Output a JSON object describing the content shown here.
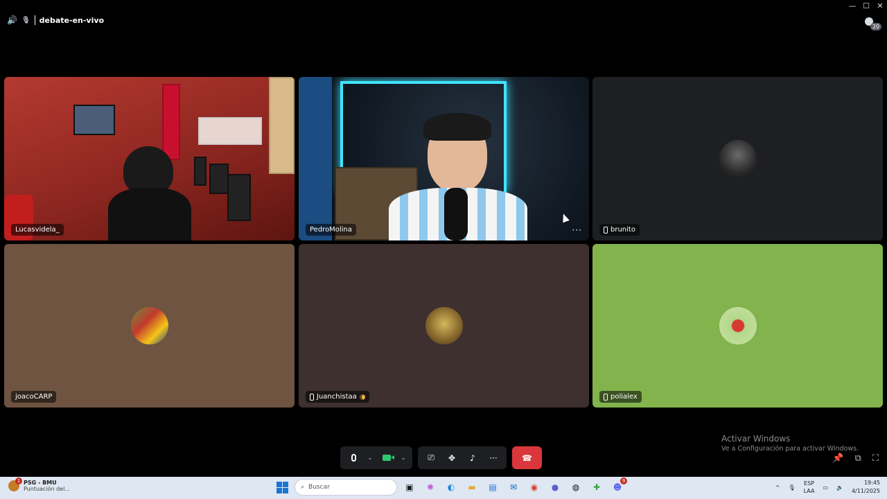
{
  "window": {
    "controls": {
      "minimize": "—",
      "maximize": "☐",
      "close": "✕"
    }
  },
  "header": {
    "channel_name": "debate-en-vivo",
    "viewer_count": "20"
  },
  "participants": [
    {
      "name": "Lucasvidela_",
      "mobile": false
    },
    {
      "name": "PedroMolina",
      "mobile": false
    },
    {
      "name": "brunito",
      "mobile": true
    },
    {
      "name": "joacoCARP",
      "mobile": false
    },
    {
      "name": "Juanchistaa",
      "mobile": true,
      "status": "idle"
    },
    {
      "name": "polialex",
      "mobile": true
    }
  ],
  "watermark": {
    "title": "Activar Windows",
    "subtitle": "Ve a Configuración para activar Windows."
  },
  "controls": {
    "more": "···"
  },
  "taskbar": {
    "news_title": "PSG - BMU",
    "news_subtitle": "Puntuación del...",
    "news_badge": "1",
    "search_placeholder": "Buscar",
    "language": "ESP",
    "keyboard": "LAA",
    "time": "19:45",
    "date": "4/11/2025",
    "app_badge": "9"
  }
}
